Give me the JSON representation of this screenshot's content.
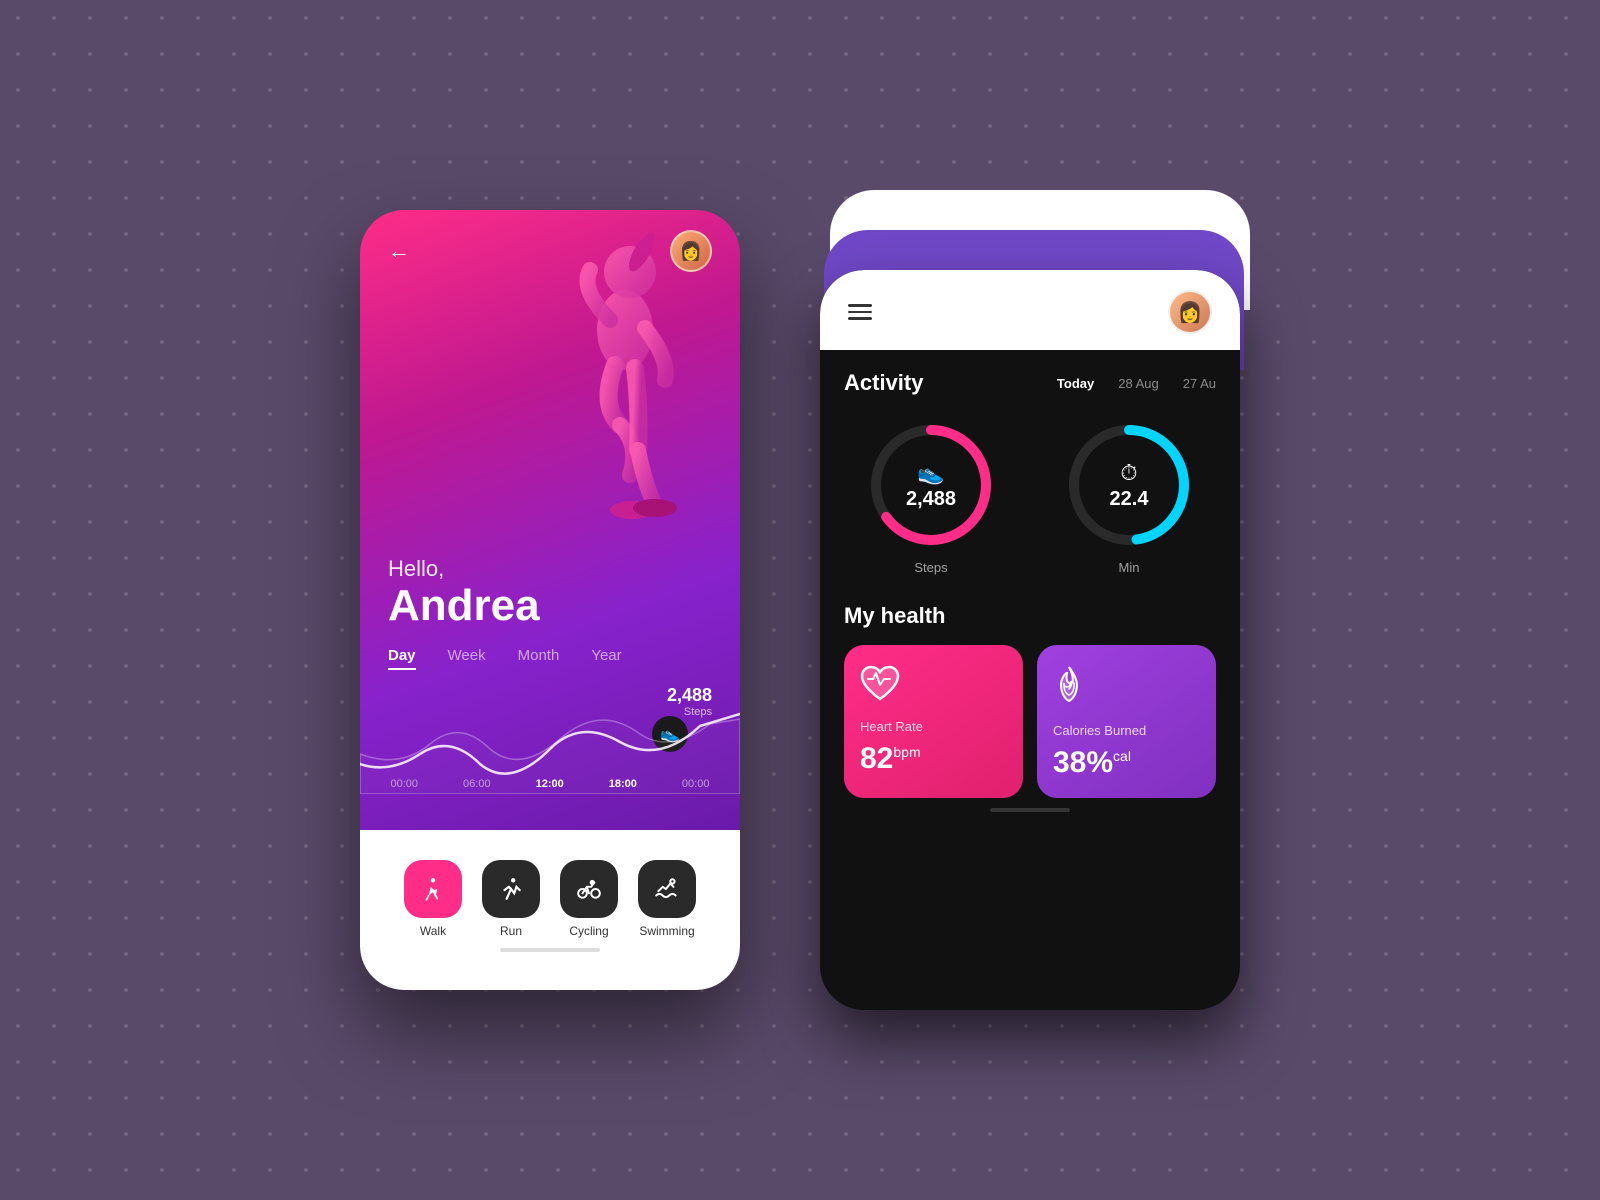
{
  "background": "#5a4a6a",
  "phone1": {
    "greeting": "Hello,",
    "name": "Andrea",
    "tabs": [
      "Day",
      "Week",
      "Month",
      "Year"
    ],
    "active_tab": "Day",
    "steps_count": "2,488",
    "steps_label": "Steps",
    "time_labels": [
      "00:00",
      "06:00",
      "12:00",
      "18:00",
      "00:00"
    ],
    "active_time": "18:00",
    "nav_items": [
      {
        "id": "walk",
        "label": "Walk",
        "active": true
      },
      {
        "id": "run",
        "label": "Run",
        "active": false
      },
      {
        "id": "cycling",
        "label": "Cycling",
        "active": false
      },
      {
        "id": "swimming",
        "label": "Swimming",
        "active": false
      }
    ]
  },
  "phone2": {
    "activity": {
      "title": "Activity",
      "dates": [
        "Today",
        "28 Aug",
        "27 Au"
      ],
      "active_date": "Today",
      "circles": [
        {
          "id": "steps",
          "icon": "👟",
          "value": "2,488",
          "label": "Steps",
          "color": "pink"
        },
        {
          "id": "time",
          "icon": "⏱",
          "value": "22.4",
          "label": "Min",
          "color": "cyan"
        }
      ]
    },
    "health": {
      "title": "My health",
      "cards": [
        {
          "id": "heart-rate",
          "label": "Heart Rate",
          "value": "82",
          "unit": "bpm",
          "color": "pink"
        },
        {
          "id": "calories",
          "label": "Calories Burned",
          "value": "38%",
          "unit": "cal",
          "color": "purple"
        }
      ]
    }
  },
  "icons": {
    "back_arrow": "←",
    "hamburger": "≡",
    "shoe": "👟",
    "stopwatch": "⏱",
    "heart": "♥",
    "flame": "🔥",
    "walk": "🚶",
    "run": "🏃",
    "cycling": "🚴",
    "swimming": "🏊"
  }
}
